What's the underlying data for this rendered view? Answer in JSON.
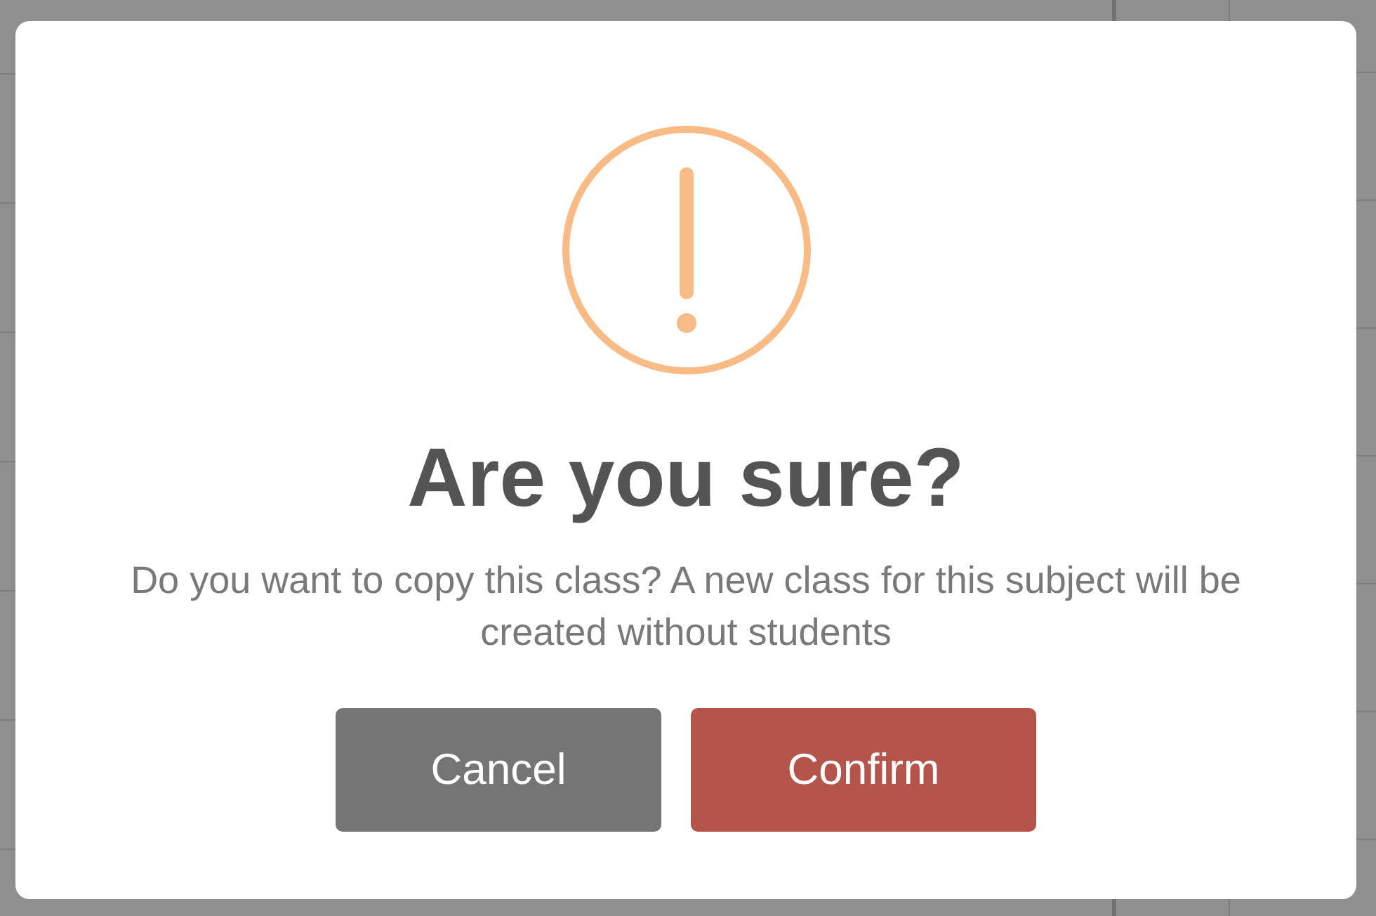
{
  "dialog": {
    "kind": "warning",
    "title": "Are you sure?",
    "message": "Do you want to copy this class? A new class for this subject will be created without students",
    "buttons": [
      {
        "kind": "cancel",
        "label": "Cancel"
      },
      {
        "kind": "confirm",
        "label": "Confirm"
      }
    ]
  }
}
